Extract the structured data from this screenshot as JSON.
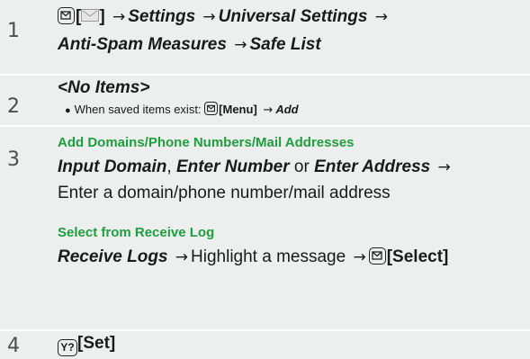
{
  "steps": [
    {
      "number": "1",
      "line1": {
        "key_label": "[",
        "key_label_end": "]",
        "path": [
          "Settings",
          "Universal Settings"
        ]
      },
      "line2": {
        "path": [
          "Anti-Spam Measures",
          "Safe List"
        ]
      }
    },
    {
      "number": "2",
      "title": "<No Items>",
      "note": {
        "prefix": "When saved items exist:",
        "menu_label": "[Menu]",
        "action": "Add"
      }
    },
    {
      "number": "3",
      "section1": {
        "heading": "Add Domains/Phone Numbers/Mail Addresses",
        "opt1": "Input Domain",
        "sep1": ",",
        "opt2": "Enter Number",
        "or": "or",
        "opt3": "Enter Address",
        "desc": "Enter a domain/phone number/mail address"
      },
      "section2": {
        "heading": "Select from Receive Log",
        "opt": "Receive Logs",
        "highlight": "Highlight a message",
        "select_label": "[Select]"
      }
    },
    {
      "number": "4",
      "key_symbol": "Y?",
      "label": "[Set]"
    }
  ],
  "colors": {
    "heading_green": "#1e9e3e",
    "step_bg": "#edeeee"
  },
  "icons": {
    "mail_key": "mail-key-icon",
    "arrow": "arrow-right-icon",
    "yahoo_key": "y-key-icon"
  }
}
